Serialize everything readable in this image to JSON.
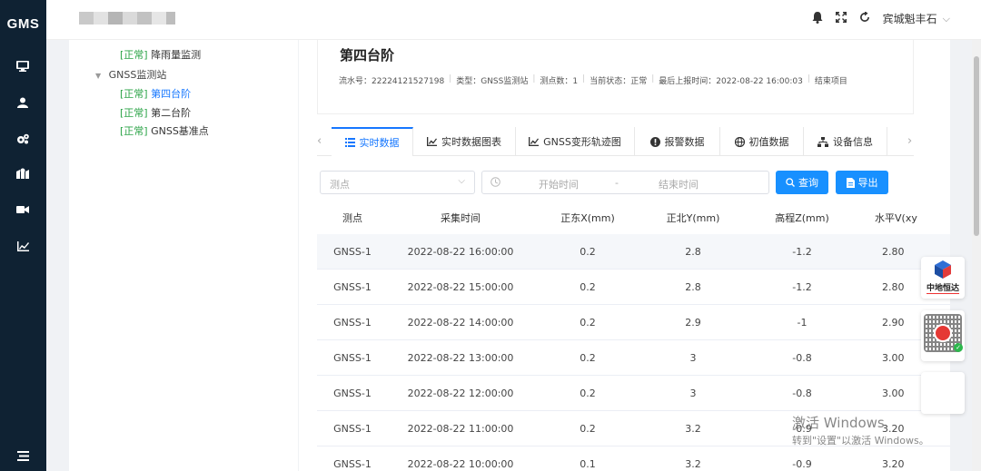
{
  "app": {
    "brand": "GMS"
  },
  "nav_icons": [
    "monitor-icon",
    "user-icon",
    "gears-icon",
    "map-icon",
    "video-icon",
    "chart-icon",
    "menu-icon"
  ],
  "topbar": {
    "user_name": "宾城魁丰石",
    "icons": [
      "bell-icon",
      "fullscreen-icon",
      "refresh-icon"
    ]
  },
  "tree": {
    "items": [
      {
        "status": "[正常]",
        "label": "降雨量监测",
        "level": 2
      },
      {
        "label": "GNSS监测站",
        "level": 1,
        "expanded": true
      },
      {
        "status": "[正常]",
        "label": "第四台阶",
        "level": 2,
        "active": true
      },
      {
        "status": "[正常]",
        "label": "第二台阶",
        "level": 2
      },
      {
        "status": "[正常]",
        "label": "GNSS基准点",
        "level": 2
      }
    ]
  },
  "header": {
    "title": "第四台阶",
    "meta": [
      "流水号：22224121527198",
      "类型：GNSS监测站",
      "测点数：1",
      "当前状态：正常",
      "最后上报时间：2022-08-22 16:00:03",
      "结束项目"
    ]
  },
  "tabs": [
    {
      "label": "实时数据",
      "icon": "list-icon",
      "active": true
    },
    {
      "label": "实时数据图表",
      "icon": "line-chart-icon"
    },
    {
      "label": "GNSS变形轨迹图",
      "icon": "line-chart-icon"
    },
    {
      "label": "报警数据",
      "icon": "alert-icon"
    },
    {
      "label": "初值数据",
      "icon": "globe-icon"
    },
    {
      "label": "设备信息",
      "icon": "sitemap-icon"
    }
  ],
  "filters": {
    "point_placeholder": "测点",
    "start_placeholder": "开始时间",
    "separator": "-",
    "end_placeholder": "结束时间",
    "query_label": "查询",
    "export_label": "导出"
  },
  "table": {
    "columns": [
      "测点",
      "采集时间",
      "正东X(mm)",
      "正北Y(mm)",
      "高程Z(mm)",
      "水平V(xy"
    ],
    "rows": [
      [
        "GNSS-1",
        "2022-08-22 16:00:00",
        "0.2",
        "2.8",
        "-1.2",
        "2.80"
      ],
      [
        "GNSS-1",
        "2022-08-22 15:00:00",
        "0.2",
        "2.8",
        "-1.2",
        "2.80"
      ],
      [
        "GNSS-1",
        "2022-08-22 14:00:00",
        "0.2",
        "2.9",
        "-1",
        "2.90"
      ],
      [
        "GNSS-1",
        "2022-08-22 13:00:00",
        "0.2",
        "3",
        "-0.8",
        "3.00"
      ],
      [
        "GNSS-1",
        "2022-08-22 12:00:00",
        "0.2",
        "3",
        "-0.8",
        "3.00"
      ],
      [
        "GNSS-1",
        "2022-08-22 11:00:00",
        "0.2",
        "3.2",
        "-0.9",
        "3.20"
      ],
      [
        "GNSS-1",
        "2022-08-22 10:00:00",
        "0.1",
        "3.2",
        "-0.9",
        "3.20"
      ]
    ]
  },
  "side": {
    "brand_label": "中地恒达"
  },
  "watermark": {
    "line1": "激活 Windows",
    "line2": "转到\"设置\"以激活 Windows。"
  },
  "colors": {
    "nav_bg": "#0f2233",
    "accent": "#1890ff",
    "normal": "#2aa346"
  }
}
